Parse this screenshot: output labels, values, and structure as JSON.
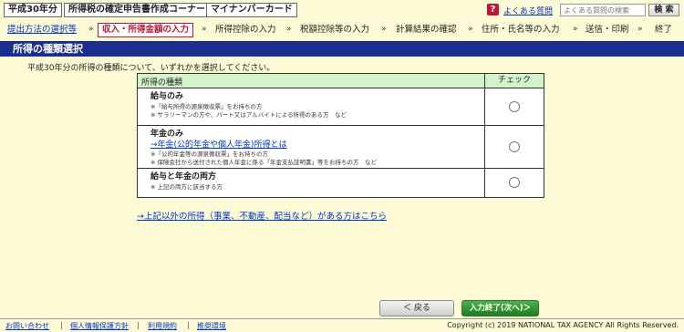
{
  "topbar": {
    "year_label": "平成30年分",
    "corner_label": "所得税の確定申告書作成コーナー",
    "mynumber_label": "マイナンバーカード",
    "help_icon_text": "?",
    "faq_link": "よくある質問",
    "search_placeholder": "よくある質問の検索",
    "search_button": "検 索"
  },
  "steps": {
    "s1": "提出方法の選択等",
    "s2": "収入・所得金額の入力",
    "s3": "所得控除の入力",
    "s4": "税額控除等の入力",
    "s5": "計算結果の確認",
    "s6": "住所・氏名等の入力",
    "s7": "送信・印刷",
    "s8": "終了",
    "separator": "»"
  },
  "main": {
    "section_title": "所得の種類選択",
    "instruction": "平成30年分の所得の種類について、いずれかを選択してください。",
    "table_header_type": "所得の種類",
    "table_header_check": "チェック",
    "row1": {
      "title": "給与のみ",
      "note1": "※「給与所得の源泉徴収票」をお持ちの方",
      "note2": "※ サラリーマンの方や、パート又はアルバイトによる所得のある方　など"
    },
    "row2": {
      "title": "年金のみ",
      "link": "→年金(公的年金や個人年金)所得とは",
      "note1": "※「公的年金等の源泉徴収票」をお持ちの方",
      "note2": "※ 保険会社から送付された個人年金に係る「年金支払証明書」等をお持ちの方　など"
    },
    "row3": {
      "title": "給与と年金の両方",
      "note1": "※ 上記の両方に該当する方"
    },
    "other_link": "→上記以外の所得（事業、不動産、配当など）がある方はこちら"
  },
  "buttons": {
    "back": "＜ 戻る",
    "next": "入力終了(次へ)＞"
  },
  "footer": {
    "contact": "お問い合わせ",
    "privacy": "個人情報保護方針",
    "terms": "利用規約",
    "env": "推奨環境",
    "separator": "|",
    "copyright": "Copyright (c) 2019 NATIONAL TAX AGENCY All Rights Reserved."
  }
}
